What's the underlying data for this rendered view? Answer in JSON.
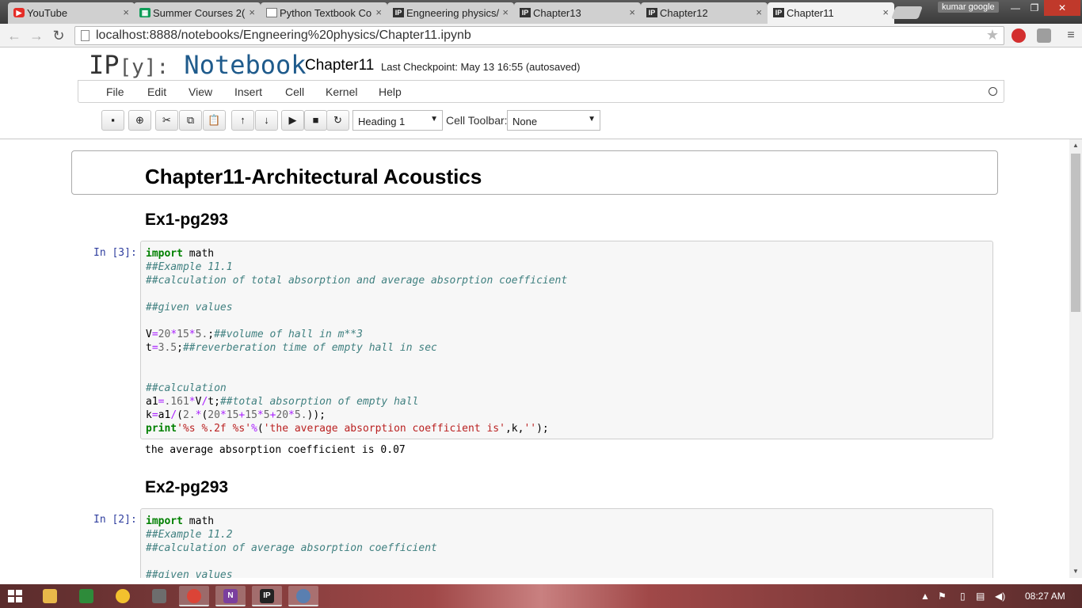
{
  "browser": {
    "tabs": [
      {
        "label": "YouTube",
        "icon": "youtube-icon"
      },
      {
        "label": "Summer Courses 2(",
        "icon": "sheets-icon"
      },
      {
        "label": "Python Textbook Co",
        "icon": "document-icon"
      },
      {
        "label": "Engneering physics/",
        "icon": "ipython-icon"
      },
      {
        "label": "Chapter13",
        "icon": "ipython-icon"
      },
      {
        "label": "Chapter12",
        "icon": "ipython-icon"
      },
      {
        "label": "Chapter11",
        "icon": "ipython-icon"
      }
    ],
    "profile_name": "kumar google",
    "url": "localhost:8888/notebooks/Engneering%20physics/Chapter11.ipynb"
  },
  "notebook": {
    "logo_ip": "IP",
    "logo_y": "[y]:",
    "logo_word": "Notebook",
    "name": "Chapter11",
    "checkpoint": "Last Checkpoint: May 13 16:55 (autosaved)",
    "menu": [
      "File",
      "Edit",
      "View",
      "Insert",
      "Cell",
      "Kernel",
      "Help"
    ],
    "cell_type": "Heading 1",
    "cell_toolbar_label": "Cell Toolbar:",
    "cell_toolbar_value": "None"
  },
  "cells": {
    "title": "Chapter11-Architectural Acoustics",
    "ex1_heading": "Ex1-pg293",
    "ex1_prompt": "In [3]:",
    "ex1_output": "the average absorption coefficient is 0.07",
    "ex2_heading": "Ex2-pg293",
    "ex2_prompt": "In [2]:"
  },
  "taskbar": {
    "clock": "08:27 AM"
  }
}
